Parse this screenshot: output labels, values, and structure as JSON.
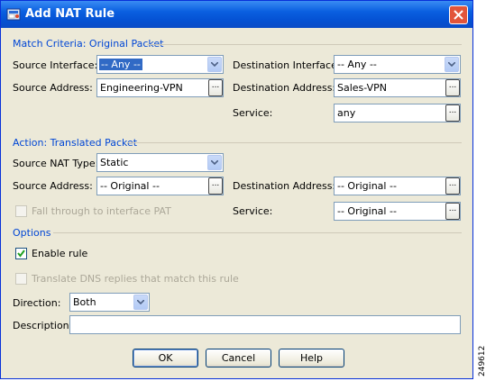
{
  "window": {
    "title": "Add NAT Rule"
  },
  "match": {
    "section_title": "Match Criteria: Original Packet",
    "source_interface_label": "Source Interface:",
    "source_interface_value": "-- Any --",
    "destination_interface_label": "Destination Interface:",
    "destination_interface_value": "-- Any --",
    "source_address_label": "Source Address:",
    "source_address_value": "Engineering-VPN",
    "destination_address_label": "Destination Address:",
    "destination_address_value": "Sales-VPN",
    "service_label": "Service:",
    "service_value": "any"
  },
  "action": {
    "section_title": "Action: Translated Packet",
    "source_nat_type_label": "Source NAT Type:",
    "source_nat_type_value": "Static",
    "source_address_label": "Source Address:",
    "source_address_value": "-- Original --",
    "destination_address_label": "Destination Address:",
    "destination_address_value": "-- Original --",
    "fall_through_label": "Fall through to interface PAT",
    "fall_through_checked": false,
    "service_label": "Service:",
    "service_value": "-- Original --"
  },
  "options": {
    "section_title": "Options",
    "enable_rule_label": "Enable rule",
    "enable_rule_checked": true,
    "translate_dns_label": "Translate DNS replies that match this rule",
    "translate_dns_checked": false,
    "direction_label": "Direction:",
    "direction_value": "Both",
    "description_label": "Description:",
    "description_value": ""
  },
  "buttons": {
    "ok": "OK",
    "cancel": "Cancel",
    "help": "Help"
  },
  "browse_label": "...",
  "side_id": "249612",
  "colors": {
    "title_bar": "#0a5fe0",
    "section_text": "#0046d5",
    "dialog_bg": "#ece9d8",
    "selection": "#316ac5"
  },
  "icons": [
    "app-icon",
    "close-icon",
    "dropdown-arrow-icon",
    "checkmark-icon"
  ]
}
